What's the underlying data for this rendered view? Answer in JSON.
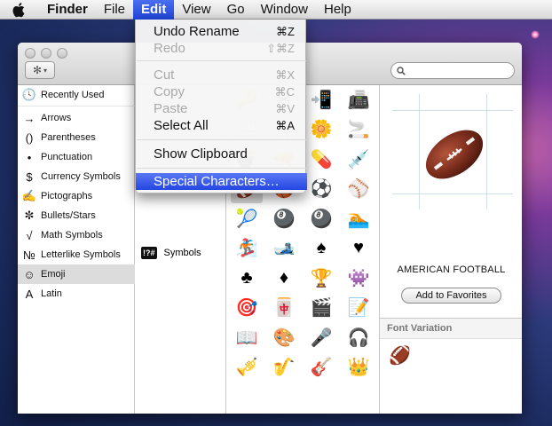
{
  "menubar": {
    "items": [
      "Finder",
      "File",
      "Edit",
      "View",
      "Go",
      "Window",
      "Help"
    ]
  },
  "edit_menu": {
    "undo": {
      "label": "Undo Rename",
      "shortcut": "⌘Z"
    },
    "redo": {
      "label": "Redo",
      "shortcut": "⇧⌘Z"
    },
    "cut": {
      "label": "Cut",
      "shortcut": "⌘X"
    },
    "copy": {
      "label": "Copy",
      "shortcut": "⌘C"
    },
    "paste": {
      "label": "Paste",
      "shortcut": "⌘V"
    },
    "select_all": {
      "label": "Select All",
      "shortcut": "⌘A"
    },
    "show_clipboard": {
      "label": "Show Clipboard"
    },
    "special_characters": {
      "label": "Special Characters…"
    }
  },
  "sidebar": {
    "items": [
      {
        "label": "Recently Used",
        "icon": "🕓"
      },
      {
        "label": "Arrows",
        "icon": "→"
      },
      {
        "label": "Parentheses",
        "icon": "()"
      },
      {
        "label": "Punctuation",
        "icon": "•"
      },
      {
        "label": "Currency Symbols",
        "icon": "$"
      },
      {
        "label": "Pictographs",
        "icon": "✍"
      },
      {
        "label": "Bullets/Stars",
        "icon": "✼"
      },
      {
        "label": "Math Symbols",
        "icon": "√"
      },
      {
        "label": "Letterlike Symbols",
        "icon": "№"
      },
      {
        "label": "Emoji",
        "icon": "☺"
      },
      {
        "label": "Latin",
        "icon": "A"
      }
    ],
    "selected": "Emoji"
  },
  "subcategories": {
    "symbols": {
      "badge": "!?#",
      "label": "Symbols"
    }
  },
  "grid": {
    "chars": [
      "🔑",
      "✂",
      "📲",
      "📠",
      "🛁",
      "🚽",
      "🌼",
      "🚬",
      "💣",
      "🔫",
      "💊",
      "💉",
      "🏈",
      "🏀",
      "⚽",
      "⚾",
      "🎾",
      "🎱",
      "🎱",
      "🏊",
      "🏂",
      "🎿",
      "♠",
      "♥",
      "♣",
      "♦",
      "🏆",
      "👾",
      "🎯",
      "🀄",
      "🎬",
      "📝",
      "📖",
      "🎨",
      "🎤",
      "🎧",
      "🎺",
      "🎷",
      "🎸",
      "👑"
    ],
    "selected_index": 12
  },
  "info": {
    "character_name": "AMERICAN FOOTBALL",
    "add_favorites": "Add to Favorites",
    "font_variation": "Font Variation",
    "variation_char": "🏈"
  },
  "search": {
    "placeholder": ""
  }
}
